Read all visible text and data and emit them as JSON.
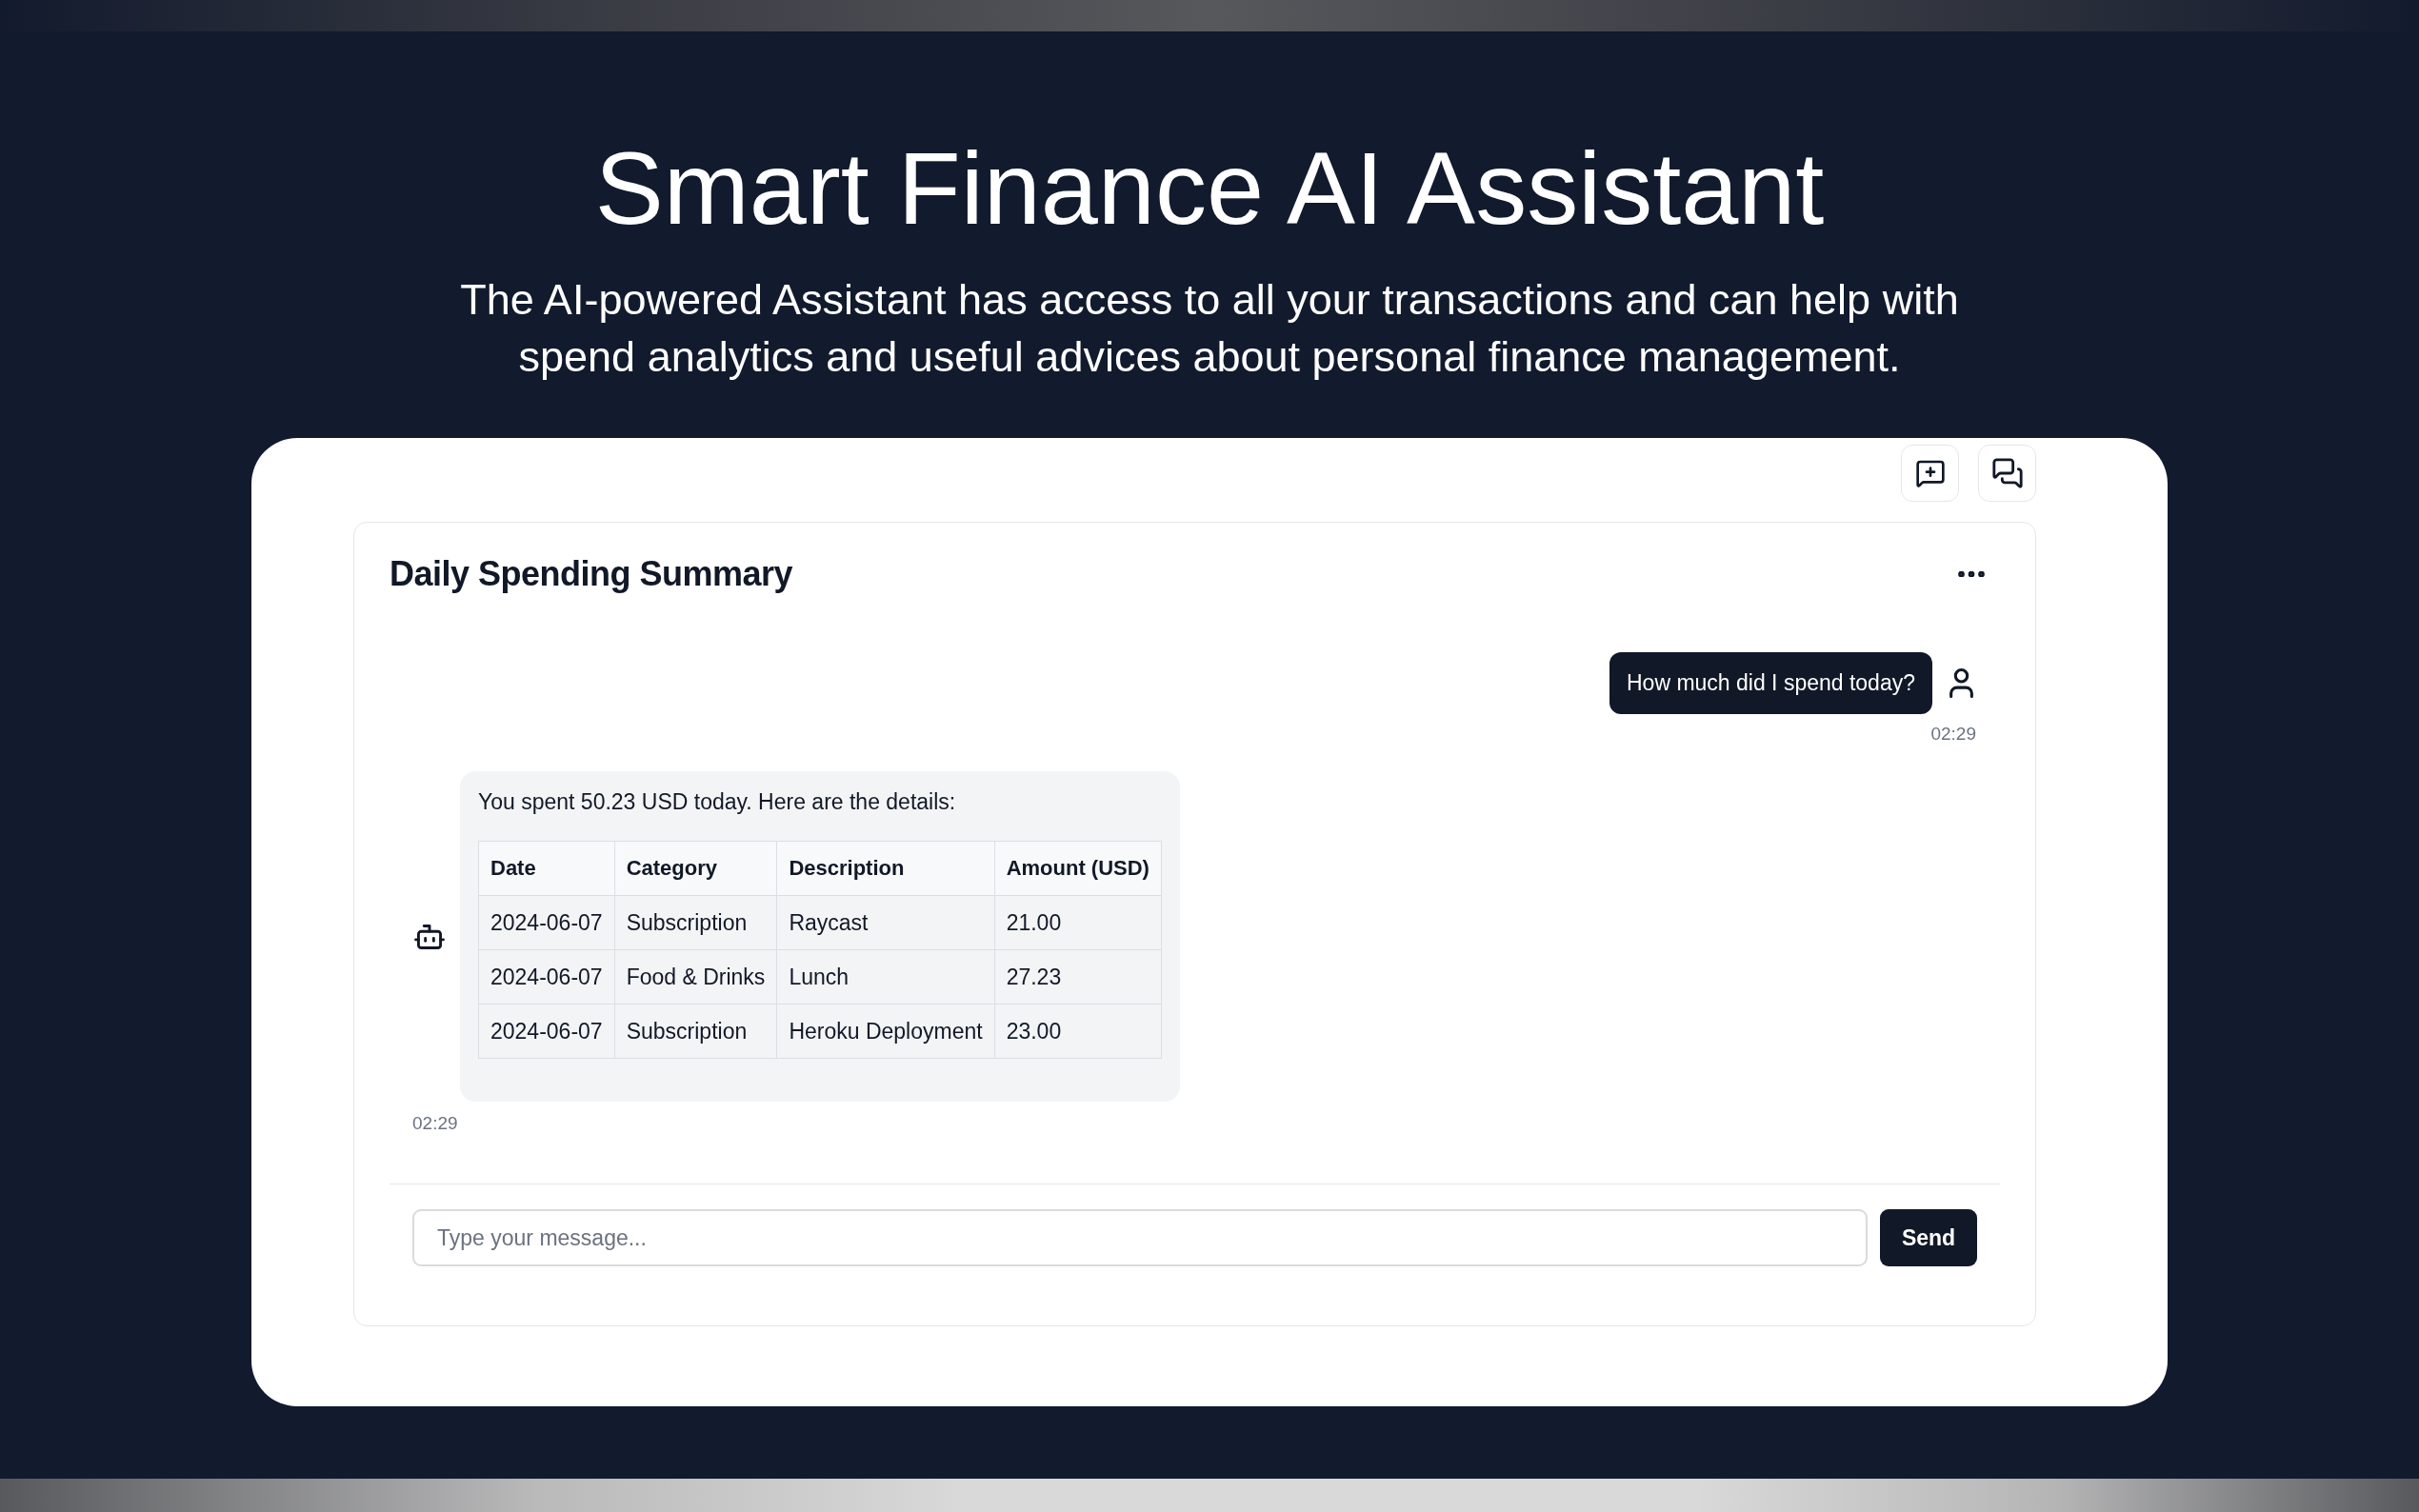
{
  "hero": {
    "title": "Smart Finance AI Assistant",
    "subtitle": "The AI-powered Assistant has access to all your transactions and can help with spend analytics and useful advices about personal finance management."
  },
  "chat": {
    "title": "Daily Spending Summary",
    "messages": [
      {
        "kind": "user",
        "text": "How much did I spend today?",
        "time": "02:29"
      },
      {
        "kind": "assistant",
        "text": "You spent 50.23 USD today. Here are the details:",
        "table": {
          "columns": [
            "Date",
            "Category",
            "Description",
            "Amount (USD)"
          ],
          "rows": [
            [
              "2024-06-07",
              "Subscription",
              "Raycast",
              "21.00"
            ],
            [
              "2024-06-07",
              "Food & Drinks",
              "Lunch",
              "27.23"
            ],
            [
              "2024-06-07",
              "Subscription",
              "Heroku Deployment",
              "23.00"
            ]
          ]
        },
        "time": "02:29"
      }
    ],
    "composer": {
      "placeholder": "Type your message...",
      "send_label": "Send"
    }
  }
}
